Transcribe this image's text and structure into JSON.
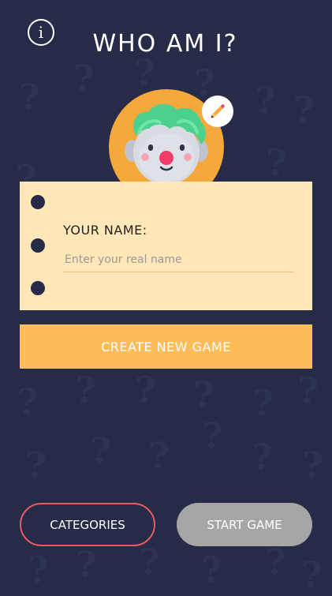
{
  "header": {
    "title": "WHO AM I?",
    "info_icon": "info-icon"
  },
  "profile": {
    "avatar": "clown-avatar",
    "edit_icon": "pencil-icon",
    "name_label": "YOUR NAME:",
    "name_placeholder": "Enter your real name",
    "name_value": ""
  },
  "actions": {
    "create_game": "CREATE NEW GAME",
    "categories": "CATEGORIES",
    "start_game": "START GAME"
  },
  "colors": {
    "background": "#262b47",
    "card": "#ffe7b8",
    "accent": "#ffbd59",
    "categories_border": "#ea5a62",
    "start_button": "#a6a6a6"
  }
}
